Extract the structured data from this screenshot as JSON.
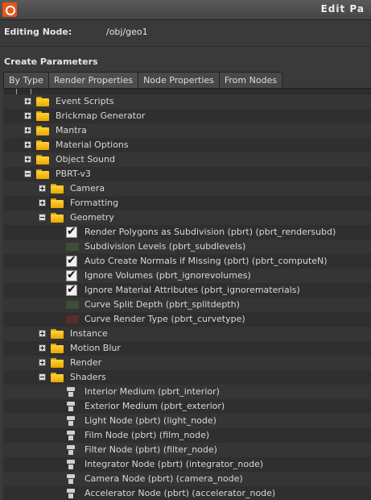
{
  "window": {
    "title": "Edit Pa"
  },
  "editing": {
    "label": "Editing Node:",
    "value": "/obj/geo1"
  },
  "section": {
    "title": "Create Parameters"
  },
  "tabs": [
    {
      "label": "By Type"
    },
    {
      "label": "Render Properties"
    },
    {
      "label": "Node Properties"
    },
    {
      "label": "From Nodes"
    }
  ],
  "tree": [
    {
      "label": "Event Scripts",
      "level": 1,
      "kind": "folder",
      "expander": "plus"
    },
    {
      "label": "Brickmap Generator",
      "level": 1,
      "kind": "folder",
      "expander": "plus"
    },
    {
      "label": "Mantra",
      "level": 1,
      "kind": "folder",
      "expander": "plus"
    },
    {
      "label": "Material Options",
      "level": 1,
      "kind": "folder",
      "expander": "plus"
    },
    {
      "label": "Object Sound",
      "level": 1,
      "kind": "folder",
      "expander": "plus"
    },
    {
      "label": "PBRT-v3",
      "level": 1,
      "kind": "folder",
      "expander": "minus"
    },
    {
      "label": "Camera",
      "level": 2,
      "kind": "folder",
      "expander": "plus"
    },
    {
      "label": "Formatting",
      "level": 2,
      "kind": "folder",
      "expander": "plus"
    },
    {
      "label": "Geometry",
      "level": 2,
      "kind": "folder",
      "expander": "minus"
    },
    {
      "label": "Render Polygons as Subdivision (pbrt) (pbrt_rendersubd)",
      "level": 3,
      "kind": "check"
    },
    {
      "label": "Subdivision Levels (pbrt_subdlevels)",
      "level": 3,
      "kind": "green"
    },
    {
      "label": "Auto Create Normals if Missing (pbrt) (pbrt_computeN)",
      "level": 3,
      "kind": "check"
    },
    {
      "label": "Ignore Volumes (pbrt_ignorevolumes)",
      "level": 3,
      "kind": "check"
    },
    {
      "label": "Ignore Material Attributes (pbrt_ignorematerials)",
      "level": 3,
      "kind": "check"
    },
    {
      "label": "Curve Split Depth (pbrt_splitdepth)",
      "level": 3,
      "kind": "green"
    },
    {
      "label": "Curve Render Type (pbrt_curvetype)",
      "level": 3,
      "kind": "red"
    },
    {
      "label": "Instance",
      "level": 2,
      "kind": "folder",
      "expander": "plus"
    },
    {
      "label": "Motion Blur",
      "level": 2,
      "kind": "folder",
      "expander": "plus"
    },
    {
      "label": "Render",
      "level": 2,
      "kind": "folder",
      "expander": "plus"
    },
    {
      "label": "Shaders",
      "level": 2,
      "kind": "folder",
      "expander": "minus"
    },
    {
      "label": "Interior Medium (pbrt_interior)",
      "level": 3,
      "kind": "node"
    },
    {
      "label": "Exterior Medium (pbrt_exterior)",
      "level": 3,
      "kind": "node"
    },
    {
      "label": "Light Node (pbrt) (light_node)",
      "level": 3,
      "kind": "node"
    },
    {
      "label": "Film Node (pbrt) (film_node)",
      "level": 3,
      "kind": "node"
    },
    {
      "label": "Filter Node (pbrt) (filter_node)",
      "level": 3,
      "kind": "node"
    },
    {
      "label": "Integrator Node (pbrt) (integrator_node)",
      "level": 3,
      "kind": "node"
    },
    {
      "label": "Camera Node (pbrt) (camera_node)",
      "level": 3,
      "kind": "node"
    },
    {
      "label": "Accelerator Node (pbrt) (accelerator_node)",
      "level": 3,
      "kind": "node"
    }
  ]
}
